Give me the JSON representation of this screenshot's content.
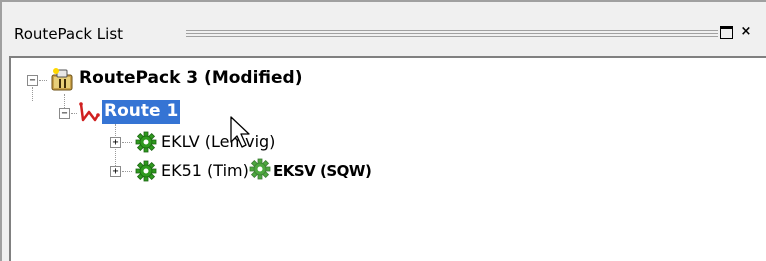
{
  "panel": {
    "title": "RoutePack List",
    "maximize_icon": "maximize-icon",
    "close_label": "×"
  },
  "tree": {
    "root": {
      "label": "RoutePack 3 (Modified)",
      "icon": "routepack-folder-icon",
      "expander": "−"
    },
    "route": {
      "label": "Route 1",
      "icon": "route-icon",
      "expander": "−",
      "selected": true
    },
    "waypoints": [
      {
        "label": "EKLV (Lemvig)",
        "icon": "waypoint-gear-icon",
        "expander": "+"
      },
      {
        "label": "EK51 (Tim)",
        "icon": "waypoint-gear-icon",
        "expander": "+"
      }
    ]
  },
  "drag": {
    "label": "EKSV (SQW)",
    "icon": "waypoint-gear-icon"
  },
  "colors": {
    "selection": "#3574d4",
    "gear": "#2e9a1e",
    "route": "#d02020"
  }
}
